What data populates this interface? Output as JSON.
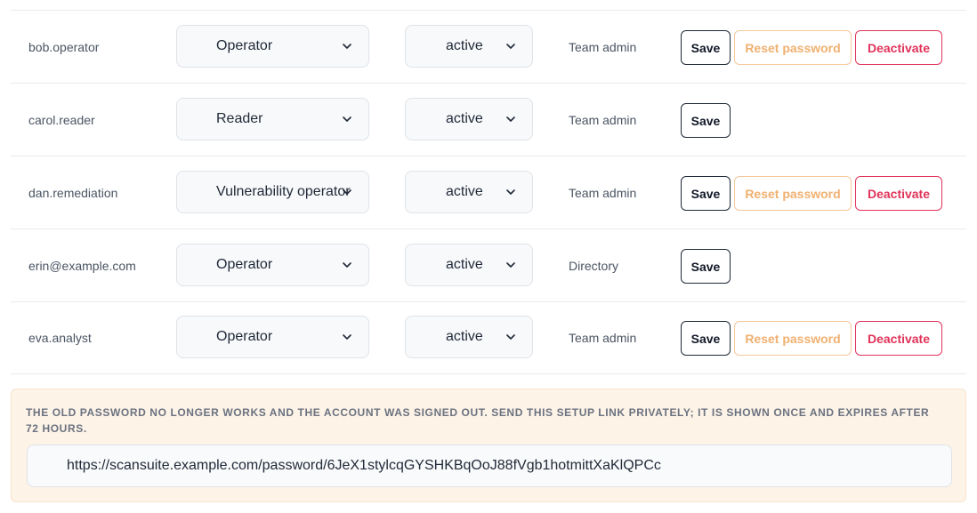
{
  "users": [
    {
      "username": "bob.operator",
      "role": "Operator",
      "status": "active",
      "source": "Team admin",
      "actions": {
        "save": "Save",
        "reset": "Reset password",
        "deactivate": "Deactivate"
      }
    },
    {
      "username": "carol.reader",
      "role": "Reader",
      "status": "active",
      "source": "Team admin",
      "actions": {
        "save": "Save"
      }
    },
    {
      "username": "dan.remediation",
      "role": "Vulnerability operator",
      "status": "active",
      "source": "Team admin",
      "actions": {
        "save": "Save",
        "reset": "Reset password",
        "deactivate": "Deactivate"
      }
    },
    {
      "username": "erin@example.com",
      "role": "Operator",
      "status": "active",
      "source": "Directory",
      "actions": {
        "save": "Save"
      }
    },
    {
      "username": "eva.analyst",
      "role": "Operator",
      "status": "active",
      "source": "Team admin",
      "actions": {
        "save": "Save",
        "reset": "Reset password",
        "deactivate": "Deactivate"
      }
    }
  ],
  "notice": {
    "message": "The old password no longer works and the account was signed out. Send this setup link privately; it is shown once and expires after 72 hours.",
    "setup_link": "https://scansuite.example.com/password/6JeX1stylcqGYSHKBqOoJ88fVgb1hotmittXaKlQPCc"
  },
  "icons": {
    "select_arrow": "chevron-down-icon"
  },
  "colors": {
    "reset_button": "#f0b070",
    "deactivate_button": "#e0335a",
    "notice_background": "#fdf3e7"
  }
}
